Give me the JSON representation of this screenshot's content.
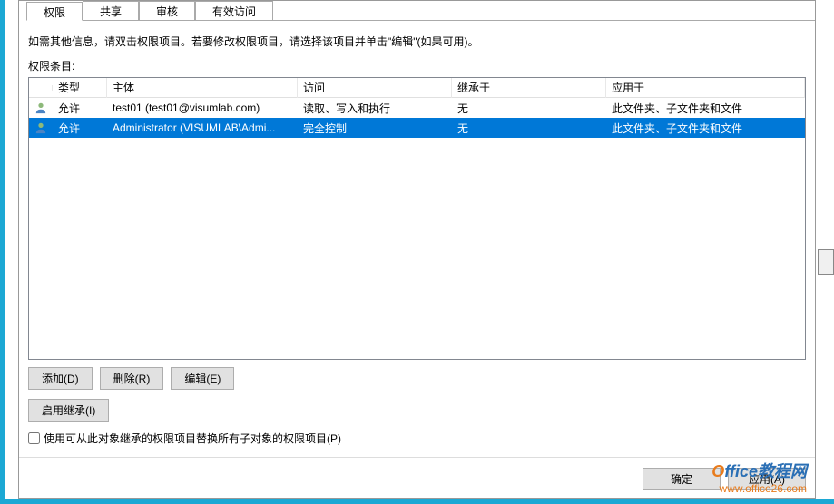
{
  "tabs": {
    "permissions": "权限",
    "share": "共享",
    "audit": "审核",
    "effective": "有效访问"
  },
  "instruction": "如需其他信息，请双击权限项目。若要修改权限项目，请选择该项目并单击\"编辑\"(如果可用)。",
  "listLabel": "权限条目:",
  "columns": {
    "type": "类型",
    "principal": "主体",
    "access": "访问",
    "inherit": "继承于",
    "applies": "应用于"
  },
  "rows": [
    {
      "type": "允许",
      "principal": "test01 (test01@visumlab.com)",
      "access": "读取、写入和执行",
      "inherit": "无",
      "applies": "此文件夹、子文件夹和文件",
      "selected": false
    },
    {
      "type": "允许",
      "principal": "Administrator (VISUMLAB\\Admi...",
      "access": "完全控制",
      "inherit": "无",
      "applies": "此文件夹、子文件夹和文件",
      "selected": true
    }
  ],
  "buttons": {
    "add": "添加(D)",
    "remove": "删除(R)",
    "edit": "编辑(E)",
    "enableInherit": "启用继承(I)",
    "ok": "确定",
    "apply": "应用(A)"
  },
  "checkboxLabel": "使用可从此对象继承的权限项目替换所有子对象的权限项目(P)",
  "watermark": {
    "line1a": "O",
    "line1b": "ffice教程网",
    "line2": "www.office26.com"
  }
}
